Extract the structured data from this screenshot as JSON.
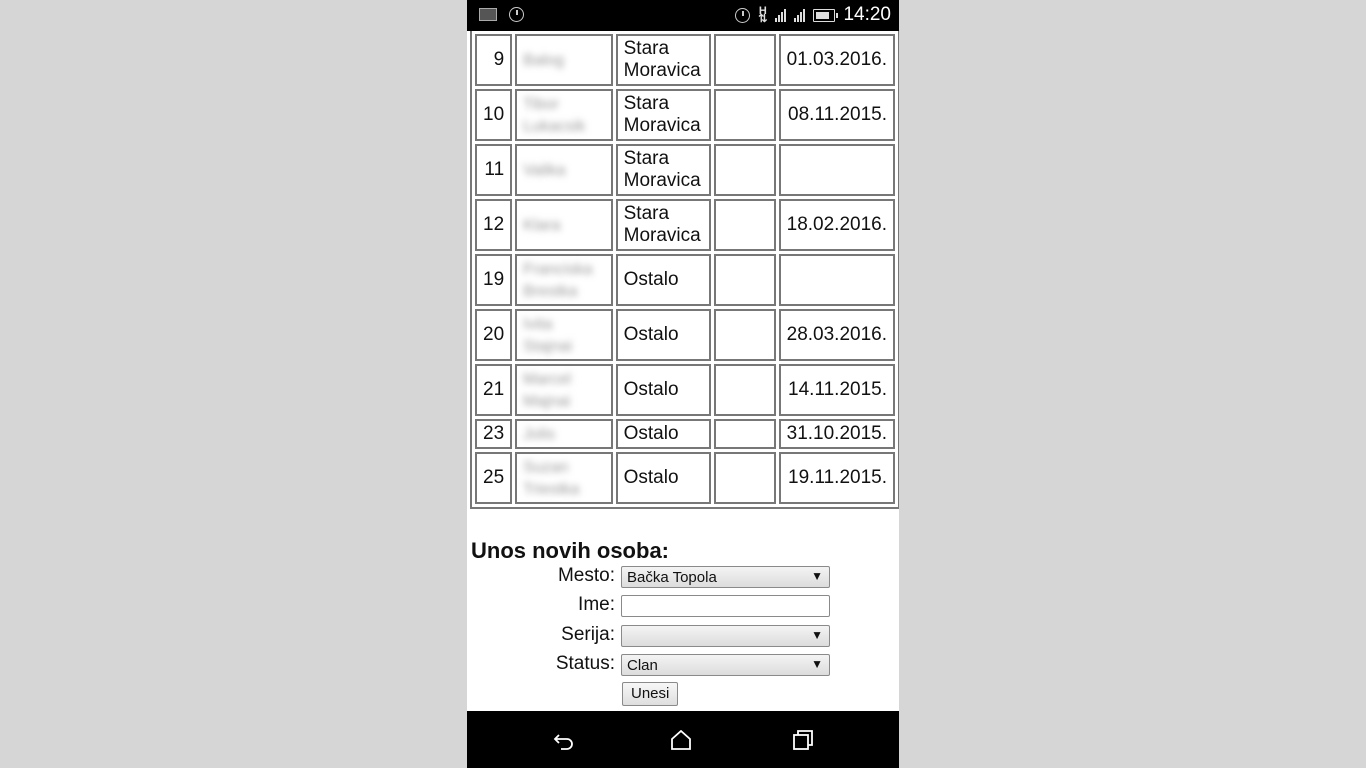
{
  "status_bar": {
    "time": "14:20",
    "network": "H"
  },
  "table": {
    "rows": [
      {
        "num": "9",
        "name": "Balog",
        "place_line1": "Stara",
        "place_line2": "Moravica",
        "extra": "",
        "date": "01.03.2016."
      },
      {
        "num": "10",
        "name": "Tibor Lukacsik",
        "place_line1": "Stara",
        "place_line2": "Moravica",
        "extra": "",
        "date": "08.11.2015."
      },
      {
        "num": "11",
        "name": "Valika",
        "place_line1": "Stara",
        "place_line2": "Moravica",
        "extra": "",
        "date": ""
      },
      {
        "num": "12",
        "name": "Klara",
        "place_line1": "Stara",
        "place_line2": "Moravica",
        "extra": "",
        "date": "18.02.2016."
      },
      {
        "num": "19",
        "name": "Franciska Brestka",
        "place_line1": "Ostalo",
        "place_line2": "",
        "extra": "",
        "date": ""
      },
      {
        "num": "20",
        "name": "Ivita Stajnai",
        "place_line1": "Ostalo",
        "place_line2": "",
        "extra": "",
        "date": "28.03.2016."
      },
      {
        "num": "21",
        "name": "Marcel Majnai",
        "place_line1": "Ostalo",
        "place_line2": "",
        "extra": "",
        "date": "14.11.2015."
      },
      {
        "num": "23",
        "name": "Jolis",
        "place_line1": "Ostalo",
        "place_line2": "",
        "extra": "",
        "date": "31.10.2015."
      },
      {
        "num": "25",
        "name": "Suzan Triestka",
        "place_line1": "Ostalo",
        "place_line2": "",
        "extra": "",
        "date": "19.11.2015."
      }
    ]
  },
  "form": {
    "title": "Unos novih osoba:",
    "mesto_label": "Mesto:",
    "mesto_value": "Bačka Topola",
    "ime_label": "Ime:",
    "ime_value": "",
    "serija_label": "Serija:",
    "serija_value": "",
    "status_label": "Status:",
    "status_value": "Clan",
    "submit_label": "Unesi"
  },
  "nav": {
    "icons": [
      "back-icon",
      "home-icon",
      "recents-icon"
    ]
  }
}
